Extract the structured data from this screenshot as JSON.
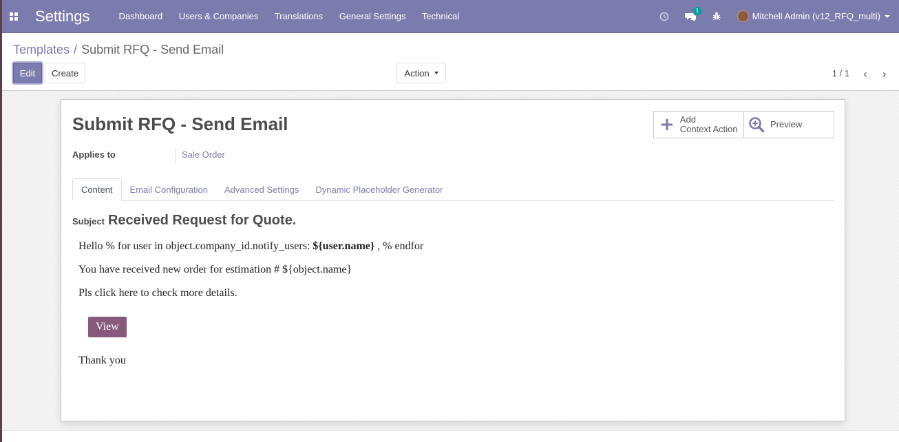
{
  "navbar": {
    "app_title": "Settings",
    "menu": [
      "Dashboard",
      "Users & Companies",
      "Translations",
      "General Settings",
      "Technical"
    ],
    "messages_badge": "1",
    "user": "Mitchell Admin (v12_RFQ_multi)",
    "icons": [
      "apps-icon",
      "clock-icon",
      "chat-icon",
      "bug-icon",
      "avatar"
    ]
  },
  "control": {
    "breadcrumb_parent": "Templates",
    "breadcrumb_sep": "/",
    "breadcrumb_current": "Submit RFQ - Send Email",
    "edit_label": "Edit",
    "create_label": "Create",
    "action_label": "Action",
    "pager": "1 / 1",
    "prev_icon": "chevron-left-icon",
    "next_icon": "chevron-right-icon"
  },
  "form": {
    "title": "Submit RFQ - Send Email",
    "buttons": {
      "add_line1": "Add",
      "add_line2": "Context Action",
      "preview": "Preview"
    },
    "applies_to_label": "Applies to",
    "applies_to_value": "Sale Order",
    "tabs": [
      "Content",
      "Email Configuration",
      "Advanced Settings",
      "Dynamic Placeholder Generator"
    ],
    "active_tab": "Content",
    "subject_label": "Subject",
    "subject_value": "Received Request for Quote.",
    "body": {
      "line1_pre": "Hello % for user in object.company_id.notify_users: ",
      "line1_bold": "${user.name}",
      "line1_post": " , % endfor",
      "line2": "You have received new order for estimation # ${object.name}",
      "line3": "Pls click here to check more details.",
      "view_button": "View",
      "closing": "Thank you"
    }
  },
  "colors": {
    "brand": "#7c7bad",
    "email_button": "#875a7b",
    "badge": "#00a09d"
  }
}
